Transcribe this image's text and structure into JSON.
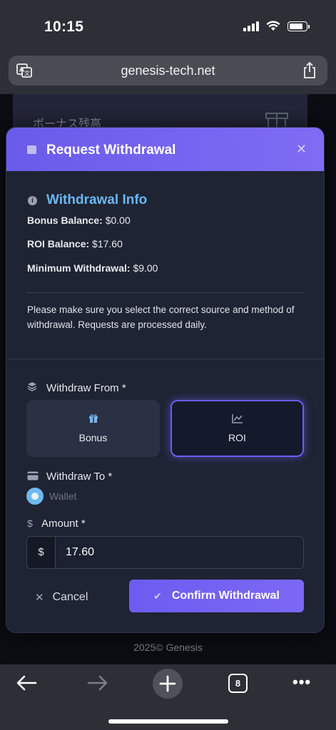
{
  "status_bar": {
    "time": "10:15"
  },
  "browser": {
    "url": "genesis-tech.net",
    "tab_count": "8"
  },
  "background_page": {
    "card_title": "ボーナス残高",
    "footer": "2025©  Genesis"
  },
  "modal": {
    "title": "Request Withdrawal",
    "info": {
      "title": "Withdrawal Info",
      "rows": [
        {
          "label": "Bonus Balance:",
          "value": "$0.00"
        },
        {
          "label": "ROI Balance:",
          "value": "$17.60"
        },
        {
          "label": "Minimum Withdrawal:",
          "value": "$9.00"
        }
      ],
      "note": "Please make sure you select the correct source and method of withdrawal. Requests are processed daily."
    },
    "withdraw_from": {
      "label": "Withdraw From *",
      "options": [
        {
          "label": "Bonus",
          "icon": "gift-icon",
          "selected": false
        },
        {
          "label": "ROI",
          "icon": "chart-line-icon",
          "selected": true
        }
      ]
    },
    "withdraw_to": {
      "label": "Withdraw To *",
      "option": "Wallet",
      "selected": true
    },
    "amount": {
      "label": "Amount *",
      "prefix": "$",
      "value": "17.60",
      "prefix_icon_label": "$"
    },
    "actions": {
      "cancel": "Cancel",
      "confirm": "Confirm Withdrawal"
    }
  },
  "colors": {
    "accent": "#6d5df0",
    "info_title": "#6bb7f2",
    "radio": "#6fb8f0"
  }
}
